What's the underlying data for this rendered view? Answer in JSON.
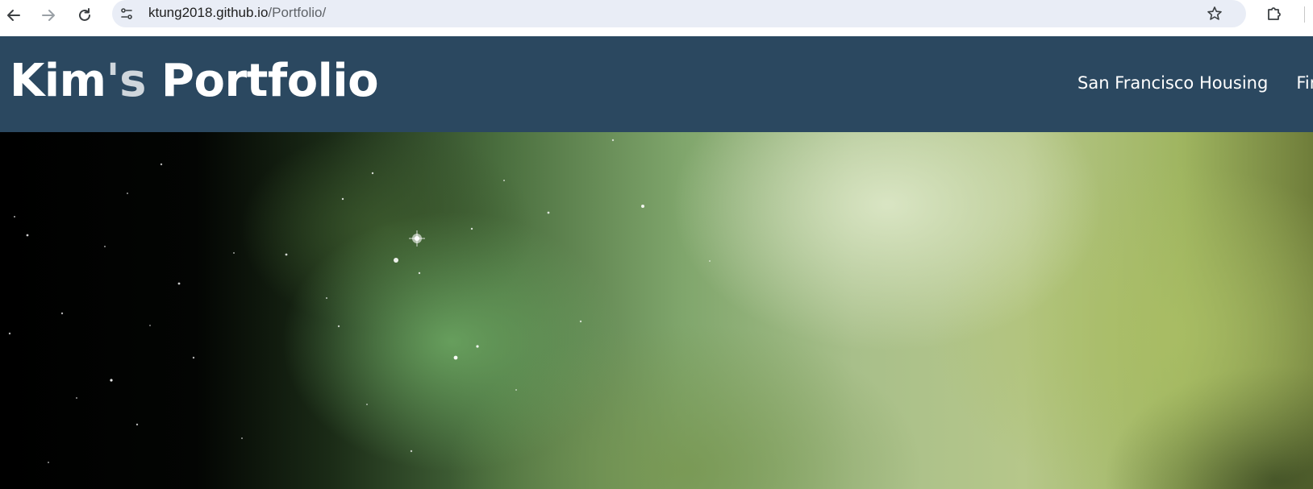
{
  "browser": {
    "url_host": "ktung2018.github.io",
    "url_path": "/Portfolio/"
  },
  "site": {
    "title_part1": "Kim",
    "title_apostrophe": "'s",
    "title_part2": " Portfolio",
    "header_color": "#2b4860",
    "nav": [
      {
        "label": "San Francisco Housing"
      },
      {
        "label": "Fin"
      }
    ]
  },
  "hero": {
    "description_colors": [
      "#000000",
      "#4a6e3e",
      "#a8bf8a",
      "#6f7d3a"
    ]
  }
}
